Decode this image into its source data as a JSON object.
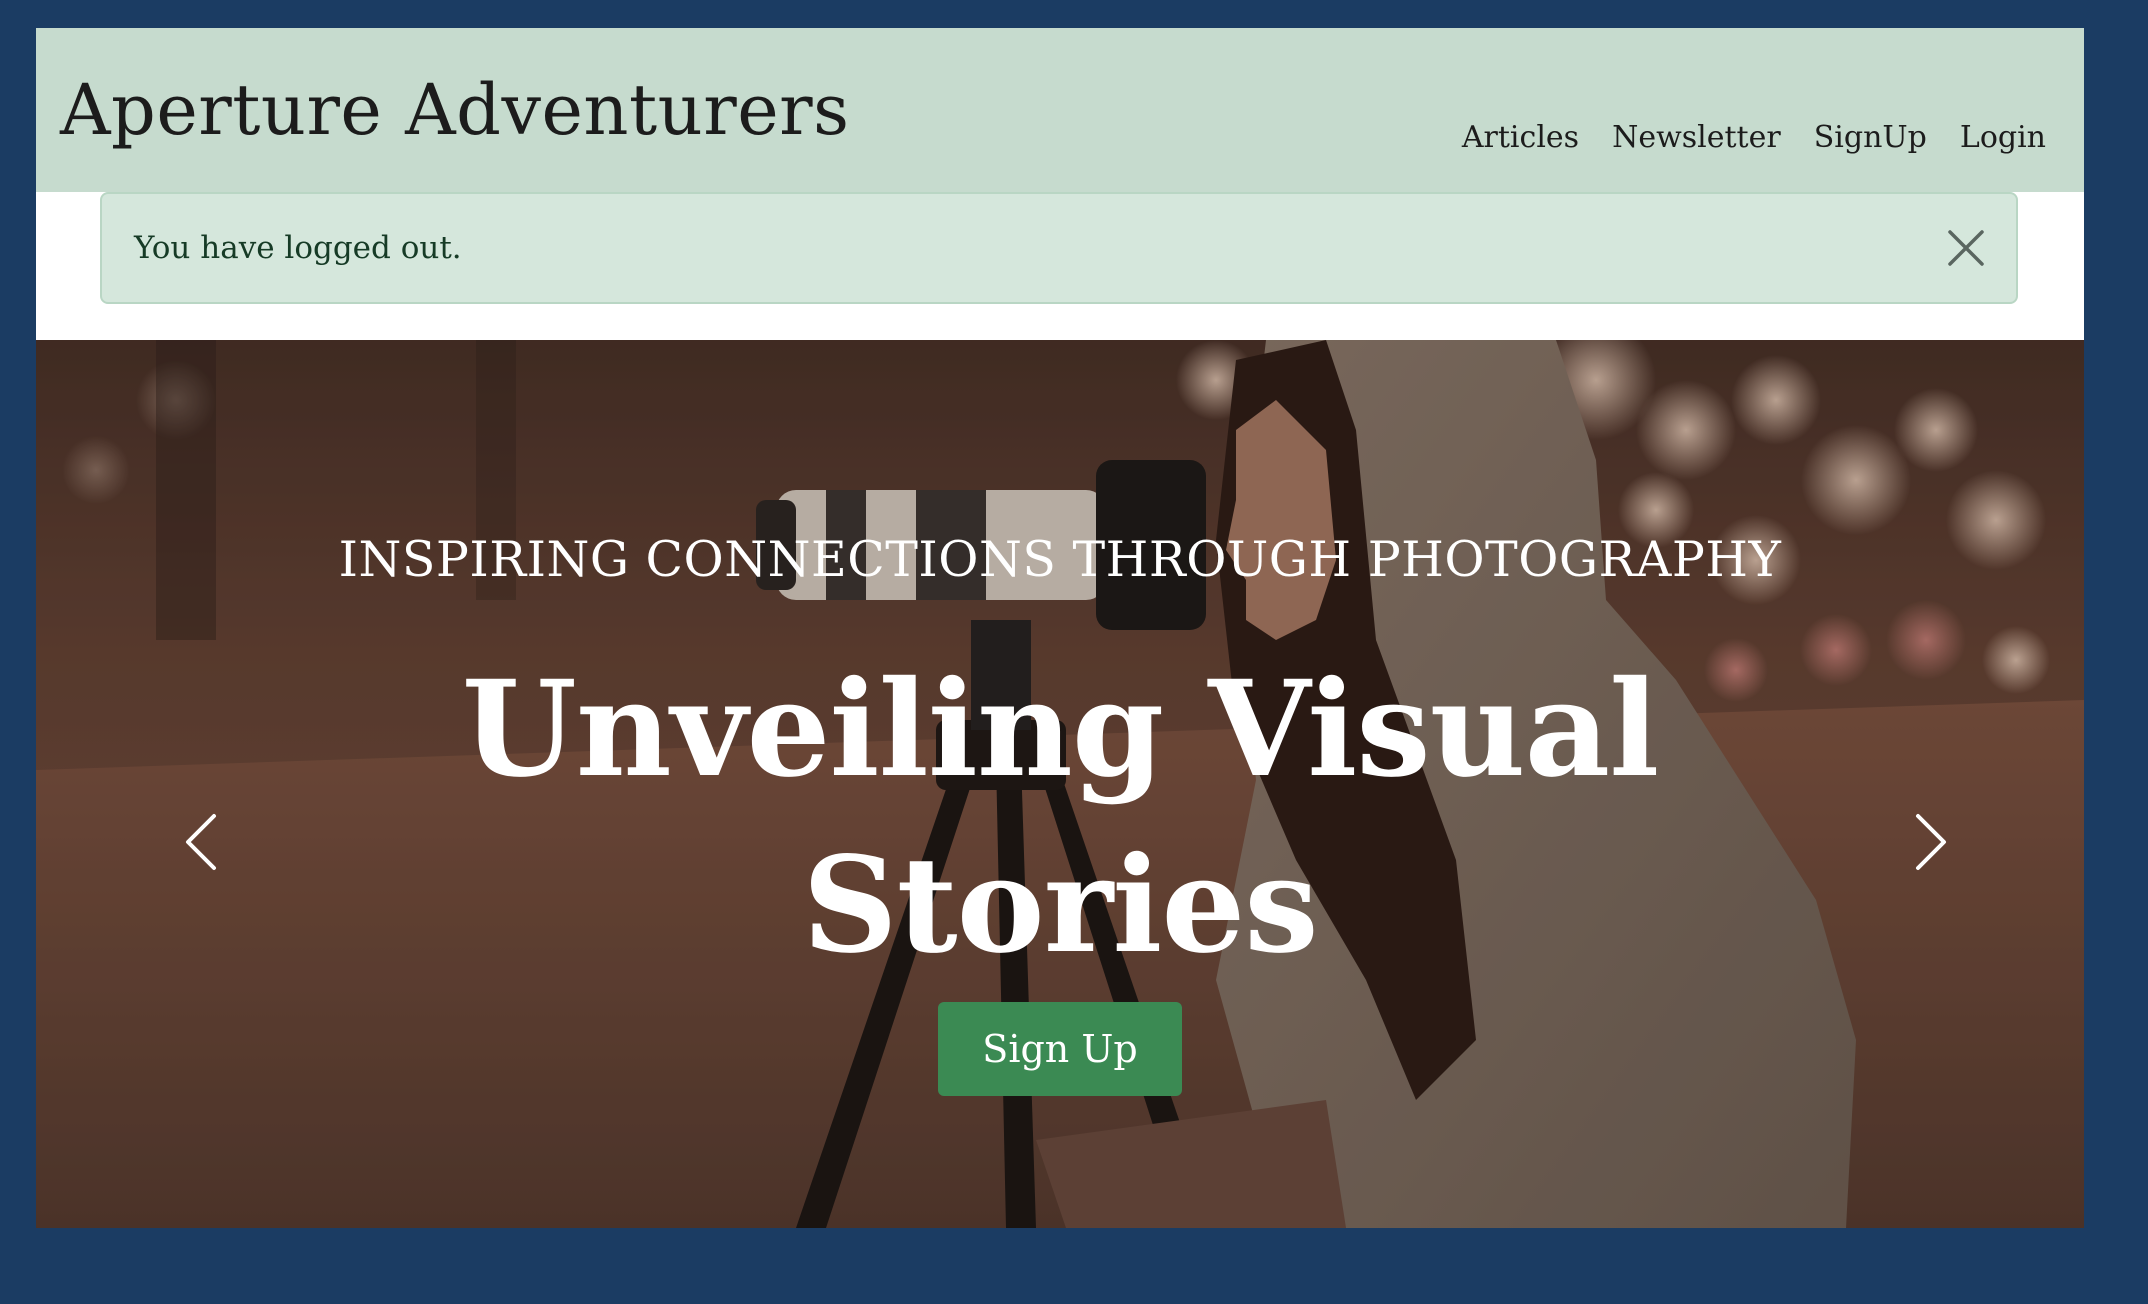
{
  "header": {
    "brand": "Aperture Adventurers",
    "nav": [
      {
        "label": "Articles"
      },
      {
        "label": "Newsletter"
      },
      {
        "label": "SignUp"
      },
      {
        "label": "Login"
      }
    ]
  },
  "alert": {
    "message": "You have logged out.",
    "close_icon": "close-icon"
  },
  "hero": {
    "kicker": "INSPIRING CONNECTIONS THROUGH PHOTOGRAPHY",
    "title": "Unveiling Visual Stories",
    "cta_label": "Sign Up",
    "prev_icon": "chevron-left-icon",
    "next_icon": "chevron-right-icon"
  },
  "colors": {
    "page_background": "#1b3c63",
    "navbar_background": "#c6dbce",
    "alert_background": "#d5e7dc",
    "alert_text": "#163b26",
    "cta_background": "#3b8a53"
  }
}
